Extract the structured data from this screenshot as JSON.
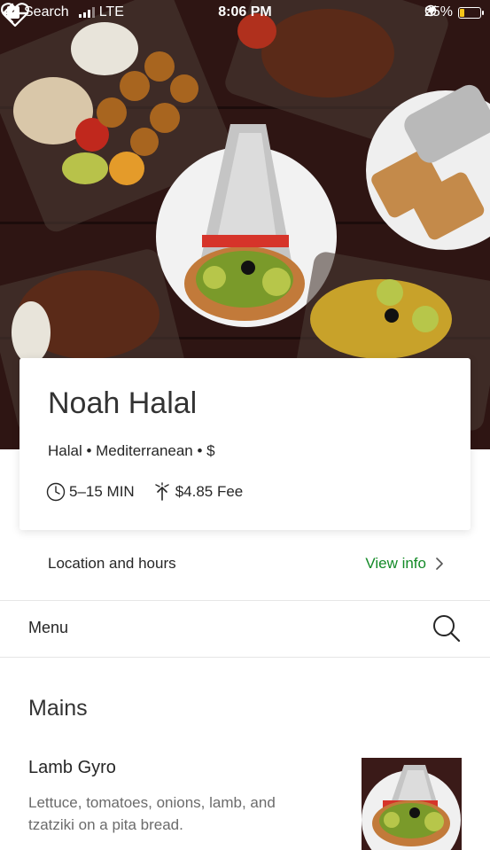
{
  "status_bar": {
    "back_app": "Search",
    "network": "LTE",
    "time": "8:06 PM",
    "battery": "25%",
    "battery_level": 0.25
  },
  "store": {
    "name": "Noah Halal",
    "cuisine": "Halal • Mediterranean • $",
    "eta": "5–15 MIN",
    "fee": "$4.85 Fee"
  },
  "location": {
    "label": "Location and hours",
    "link": "View info"
  },
  "menu": {
    "label": "Menu"
  },
  "section": {
    "title": "Mains"
  },
  "items": [
    {
      "name": "Lamb Gyro",
      "description": "Lettuce, tomatoes, onions, lamb, and tzatziki on a pita bread."
    }
  ],
  "colors": {
    "accent": "#138a27",
    "hero_bg": "#2a1514"
  },
  "icons": {
    "back": "arrow-left-icon",
    "favorite": "heart-icon",
    "clock": "clock-icon",
    "fee": "delivery-fee-icon",
    "chevron": "chevron-right-icon",
    "search": "search-icon"
  }
}
